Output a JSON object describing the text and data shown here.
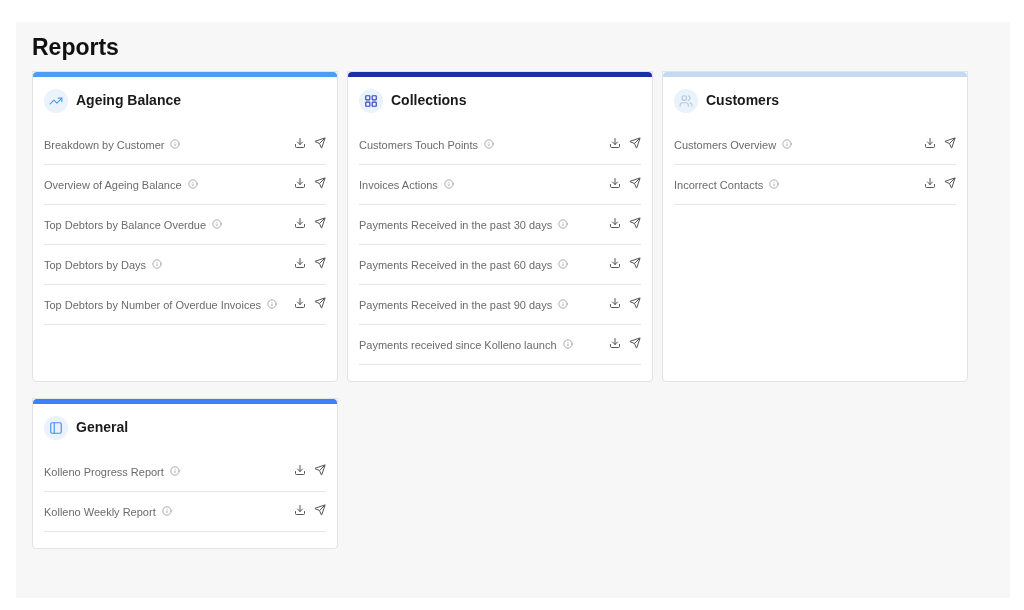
{
  "page_title": "Reports",
  "cards": [
    {
      "title": "Ageing Balance",
      "kind": "trend",
      "color": "#4a9ff5",
      "reports": [
        "Breakdown by Customer",
        "Overview of Ageing Balance",
        "Top Debtors by Balance Overdue",
        "Top Debtors by Days",
        "Top Debtors by Number of Overdue Invoices"
      ]
    },
    {
      "title": "Collections",
      "kind": "grid",
      "color": "#1a2fa8",
      "reports": [
        "Customers Touch Points",
        "Invoices Actions",
        "Payments Received in the past 30 days",
        "Payments Received in the past 60 days",
        "Payments Received in the past 90 days",
        "Payments received since Kolleno launch"
      ]
    },
    {
      "title": "Customers",
      "kind": "users",
      "color": "#c5d9f0",
      "reports": [
        "Customers Overview",
        "Incorrect Contacts"
      ]
    },
    {
      "title": "General",
      "kind": "panel",
      "color": "#3b82f6",
      "reports": [
        "Kolleno Progress Report",
        "Kolleno Weekly Report"
      ]
    }
  ]
}
